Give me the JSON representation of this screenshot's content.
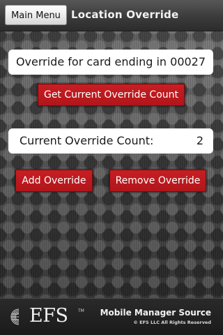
{
  "header": {
    "menu_button_label": "Main Menu",
    "title": "Location Override"
  },
  "card_panel": {
    "text": "Override for card ending in 00027"
  },
  "actions": {
    "get_count_label": "Get Current Override Count",
    "add_label": "Add Override",
    "remove_label": "Remove Override"
  },
  "count_panel": {
    "label": "Current Override Count:",
    "value": "2"
  },
  "footer": {
    "logo_text": "EFS",
    "logo_tm": "TM",
    "brand_title": "Mobile Manager Source",
    "copyright": "© EFS LLC All Rights Reserved"
  },
  "colors": {
    "accent_red": "#c71e23",
    "panel_white": "#ffffff",
    "topbar_dark": "#3b3b3b"
  },
  "icons": {
    "logo": "efs-globe-icon"
  }
}
